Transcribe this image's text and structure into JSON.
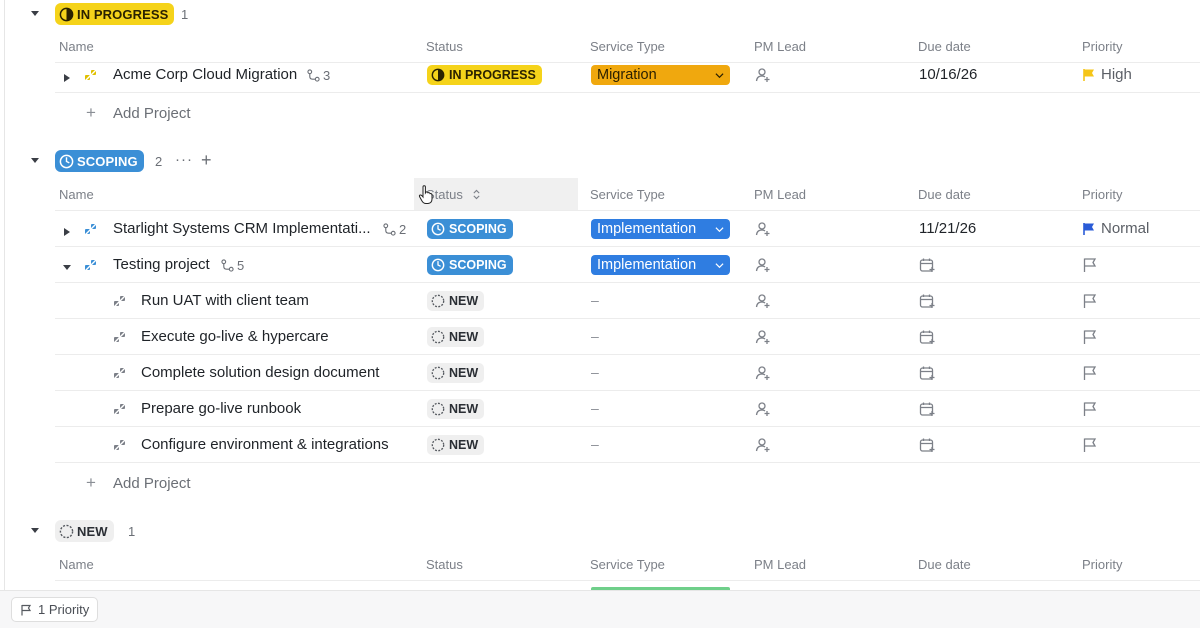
{
  "groups": [
    {
      "badge": "IN PROGRESS",
      "count": "1",
      "color": "#f5d31a",
      "columns": [
        "Name",
        "Status",
        "Service Type",
        "PM Lead",
        "Due date",
        "Priority"
      ],
      "rows": [
        {
          "name": "Acme Corp Cloud Migration",
          "subtasks": "3",
          "status": "IN PROGRESS",
          "service": "Migration",
          "due": "10/16/26",
          "priority": "High"
        }
      ],
      "add_label": "Add Project"
    },
    {
      "badge": "SCOPING",
      "count": "2",
      "color": "#3b8fd6",
      "columns": [
        "Name",
        "Status",
        "Service Type",
        "PM Lead",
        "Due date",
        "Priority"
      ],
      "rows": [
        {
          "name": "Starlight Systems CRM Implementati...",
          "subtasks": "2",
          "status": "SCOPING",
          "service": "Implementation",
          "due": "11/21/26",
          "priority": "Normal"
        },
        {
          "name": "Testing project",
          "subtasks": "5",
          "status": "SCOPING",
          "service": "Implementation",
          "due": "",
          "priority": ""
        }
      ],
      "subtasks": [
        {
          "name": "Run UAT with client team",
          "status": "NEW",
          "service": "–"
        },
        {
          "name": "Execute go-live & hypercare",
          "status": "NEW",
          "service": "–"
        },
        {
          "name": "Complete solution design document",
          "status": "NEW",
          "service": "–"
        },
        {
          "name": "Prepare go-live runbook",
          "status": "NEW",
          "service": "–"
        },
        {
          "name": "Configure environment & integrations",
          "status": "NEW",
          "service": "–"
        }
      ],
      "add_label": "Add Project"
    },
    {
      "badge": "NEW",
      "count": "1",
      "columns": [
        "Name",
        "Status",
        "Service Type",
        "PM Lead",
        "Due date",
        "Priority"
      ]
    }
  ],
  "footer": {
    "priority_chip": "1 Priority"
  },
  "colors": {
    "in_progress": "#f5d31a",
    "scoping": "#3b8fd6",
    "migration": "#f0a80e",
    "implementation": "#2f7de1",
    "high_flag": "#f5c518",
    "normal_flag": "#2a5bd7",
    "new_bg": "#efefef"
  }
}
